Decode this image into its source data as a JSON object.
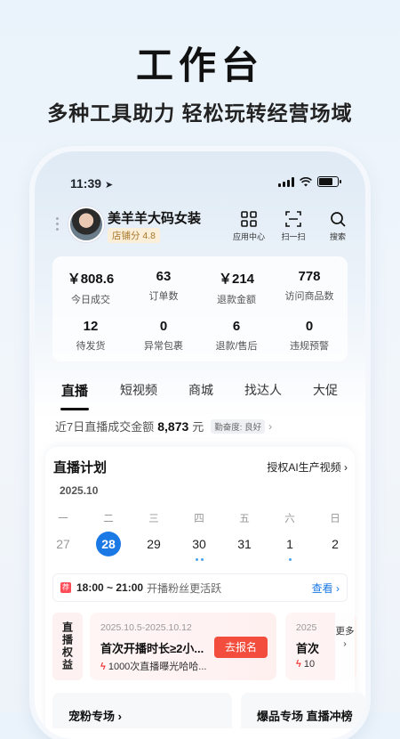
{
  "hero": {
    "title": "工作台",
    "subtitle": "多种工具助力 轻松玩转经营场域"
  },
  "status_bar": {
    "time": "11:39"
  },
  "shop": {
    "name": "美羊羊大码女装",
    "score": "店铺分 4.8",
    "actions": [
      {
        "label": "应用中心",
        "icon": "app-grid-icon"
      },
      {
        "label": "扫一扫",
        "icon": "scan-icon"
      },
      {
        "label": "搜索",
        "icon": "search-icon"
      }
    ]
  },
  "stats": [
    {
      "value": "￥808.6",
      "label": "今日成交"
    },
    {
      "value": "63",
      "label": "订单数"
    },
    {
      "value": "￥214",
      "label": "退款金额"
    },
    {
      "value": "778",
      "label": "访问商品数"
    },
    {
      "value": "12",
      "label": "待发货"
    },
    {
      "value": "0",
      "label": "异常包裹"
    },
    {
      "value": "6",
      "label": "退款/售后"
    },
    {
      "value": "0",
      "label": "违规预警"
    }
  ],
  "tabs": [
    "直播",
    "短视频",
    "商城",
    "找达人",
    "大促"
  ],
  "active_tab": "直播",
  "week_gmv": {
    "label": "近7日直播成交金额",
    "value": "8,873",
    "unit": "元",
    "chip": "勤奋度: 良好"
  },
  "live_plan": {
    "title": "直播计划",
    "link": "授权AI生产视频",
    "month": "2025.10",
    "weekdays": [
      "一",
      "二",
      "三",
      "四",
      "五",
      "六",
      "日"
    ],
    "days": [
      {
        "d": "27",
        "state": "past",
        "dots": 0
      },
      {
        "d": "28",
        "state": "selected",
        "dots": 0
      },
      {
        "d": "29",
        "state": "normal",
        "dots": 0
      },
      {
        "d": "30",
        "state": "normal",
        "dots": 2
      },
      {
        "d": "31",
        "state": "normal",
        "dots": 0
      },
      {
        "d": "1",
        "state": "normal",
        "dots": 1
      },
      {
        "d": "2",
        "state": "normal",
        "dots": 0
      }
    ],
    "slot": {
      "badge": "荐",
      "time": "18:00 ~ 21:00",
      "desc": "开播粉丝更活跃",
      "more": "查看"
    }
  },
  "rights": {
    "tag": "直播权益",
    "promos": [
      {
        "date": "2025.10.5-2025.10.12",
        "title": "首次开播时长≥2小...",
        "desc": "1000次直播曝光哈哈...",
        "button": "去报名"
      },
      {
        "date": "2025",
        "title": "首次",
        "desc": "10",
        "button": ""
      }
    ],
    "more": "更多"
  },
  "bottom": [
    "宠粉专场",
    "爆品专场 直播冲榜"
  ],
  "colors": {
    "accent": "#1b79e6",
    "danger": "#f24d3d"
  }
}
